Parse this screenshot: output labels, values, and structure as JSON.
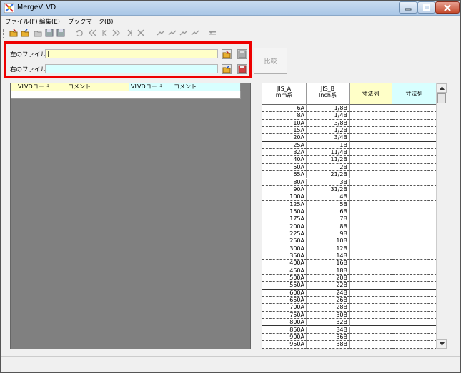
{
  "window": {
    "title": "MergeVLVD"
  },
  "menu": {
    "items": [
      "ファイル(F)",
      "編集(E)",
      "ブックマーク(B)"
    ]
  },
  "toolbar": {
    "icons": [
      "open-left-icon",
      "open-right-icon",
      "open-both-icon",
      "save-icon",
      "save-all-icon",
      "undo-icon",
      "first-icon",
      "prev-icon",
      "next-icon",
      "last-icon",
      "delete-icon",
      "merge-left-icon",
      "merge-right-icon",
      "merge-both-icon",
      "settings-icon"
    ]
  },
  "files": {
    "left_label": "左のファイル:",
    "left_value": "|",
    "right_label": "右のファイル:",
    "right_value": ""
  },
  "compare_label": "比較",
  "left_grid": {
    "columns": [
      "VLVDコード",
      "コメント",
      "VLVDコード",
      "コメント"
    ]
  },
  "right_grid": {
    "col1_line1": "JIS_A",
    "col1_line2": "mm系",
    "col2_line1": "JIS_B",
    "col2_line2": "Inch系",
    "col3": "寸法列",
    "col4": "寸法列",
    "rows": [
      [
        "6A",
        "1/8B"
      ],
      [
        "8A",
        "1/4B"
      ],
      [
        "10A",
        "3/8B"
      ],
      [
        "15A",
        "1/2B"
      ],
      [
        "20A",
        "3/4B"
      ],
      [
        "25A",
        "1B"
      ],
      [
        "32A",
        "11/4B"
      ],
      [
        "40A",
        "11/2B"
      ],
      [
        "50A",
        "2B"
      ],
      [
        "65A",
        "21/2B"
      ],
      [
        "80A",
        "3B"
      ],
      [
        "90A",
        "31/2B"
      ],
      [
        "100A",
        "4B"
      ],
      [
        "125A",
        "5B"
      ],
      [
        "150A",
        "6B"
      ],
      [
        "175A",
        "7B"
      ],
      [
        "200A",
        "8B"
      ],
      [
        "225A",
        "9B"
      ],
      [
        "250A",
        "10B"
      ],
      [
        "300A",
        "12B"
      ],
      [
        "350A",
        "14B"
      ],
      [
        "400A",
        "16B"
      ],
      [
        "450A",
        "18B"
      ],
      [
        "500A",
        "20B"
      ],
      [
        "550A",
        "22B"
      ],
      [
        "600A",
        "24B"
      ],
      [
        "650A",
        "26B"
      ],
      [
        "700A",
        "28B"
      ],
      [
        "750A",
        "30B"
      ],
      [
        "800A",
        "32B"
      ],
      [
        "850A",
        "34B"
      ],
      [
        "900A",
        "36B"
      ],
      [
        "950A",
        "38B"
      ]
    ]
  },
  "colors": {
    "highlight": "#ee0000",
    "yellow": "#ffffc8",
    "cyan": "#d8ffff"
  }
}
